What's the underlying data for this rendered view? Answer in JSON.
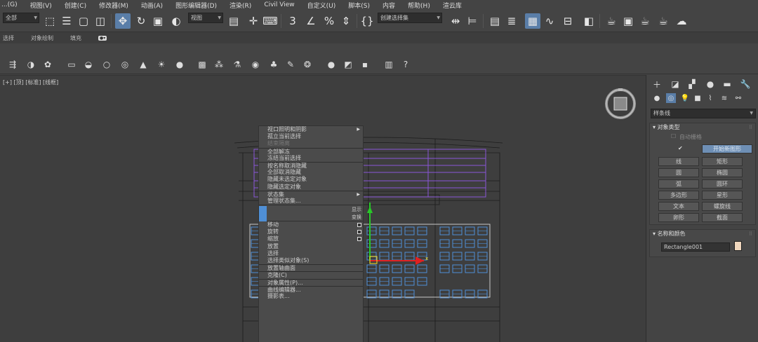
{
  "menubar": {
    "items": [
      "...(G)",
      "视图(V)",
      "创建(C)",
      "修改器(M)",
      "动画(A)",
      "图形编辑器(D)",
      "渲染(R)",
      "Civil View",
      "自定义(U)",
      "脚本(S)",
      "内容",
      "帮助(H)",
      "渲云库"
    ]
  },
  "toolbar": {
    "selection_filter": "全部",
    "ref_coord": "视图",
    "named_selection": "创建选择集"
  },
  "ribbon": {
    "tabs": [
      "选择",
      "对象绘制",
      "填充"
    ]
  },
  "viewport": {
    "label": "[+] [顶] [标准] [线框]"
  },
  "context_menu": {
    "items_top": [
      {
        "label": "视口照明和阴影",
        "submenu": true,
        "dim": false
      },
      {
        "label": "孤立当前选择",
        "dim": false
      },
      {
        "label": "结束隔离",
        "dim": true
      },
      {
        "label": "全部解冻",
        "sep": true,
        "dim": false
      },
      {
        "label": "冻结当前选择",
        "dim": false
      },
      {
        "label": "按名称取消隐藏",
        "sep": true,
        "dim": false
      },
      {
        "label": "全部取消隐藏",
        "dim": false
      },
      {
        "label": "隐藏未选定对象",
        "dim": false
      },
      {
        "label": "隐藏选定对象",
        "dim": false
      },
      {
        "label": "状态集",
        "submenu": true,
        "sep": true,
        "dim": false
      },
      {
        "label": "管理状态集...",
        "dim": false
      }
    ],
    "quad_labels": {
      "display": "显示",
      "transform": "变换"
    },
    "items_bottom": [
      {
        "label": "移动",
        "box": true
      },
      {
        "label": "旋转",
        "box": true
      },
      {
        "label": "缩放",
        "box": true
      },
      {
        "label": "放置"
      },
      {
        "label": "选择"
      },
      {
        "label": "选择类似对象(S)"
      },
      {
        "label": "放置轴曲面",
        "sep": true
      },
      {
        "label": "克隆(C)",
        "sep": true
      },
      {
        "label": "对象属性(P)...",
        "sep": true
      },
      {
        "label": "曲线编辑器...",
        "sep": true
      },
      {
        "label": "摄影表..."
      }
    ]
  },
  "command_panel": {
    "category": "样条线",
    "object_type": {
      "title": "对象类型",
      "auto_grid": "自动栅格",
      "start_new_shape": "开始新图形",
      "buttons": [
        "线",
        "矩形",
        "圆",
        "椭圆",
        "弧",
        "圆环",
        "多边形",
        "星形",
        "文本",
        "螺旋线",
        "卵形",
        "截面"
      ]
    },
    "name_color": {
      "title": "名称和颜色",
      "name": "Rectangle001",
      "color": "#f0d7be"
    }
  },
  "colors": {
    "accent": "#5a7ea8",
    "quad_blue": "#4f8fd6",
    "selection_purple": "#8a55d8"
  }
}
